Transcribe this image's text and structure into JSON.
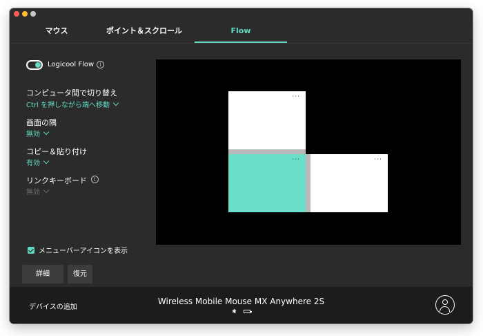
{
  "tabs": [
    {
      "label": "マウス"
    },
    {
      "label": "ポイント＆スクロール"
    },
    {
      "label": "Flow"
    }
  ],
  "flow": {
    "toggle_label": "Logicool Flow",
    "toggle_on": true
  },
  "settings": [
    {
      "title": "コンピュータ間で切り替え",
      "value": "Ctrl を押しながら端へ移動"
    },
    {
      "title": "画面の隅",
      "value": "無効"
    },
    {
      "title": "コピー＆貼り付け",
      "value": "有効"
    },
    {
      "title": "リンクキーボード",
      "value": "無効"
    }
  ],
  "menubar_checkbox_label": "メニューバーアイコンを表示",
  "buttons": {
    "detail": "詳細",
    "restore": "復元"
  },
  "screens": {
    "menu_dots": "···"
  },
  "footer": {
    "add_device": "デバイスの追加",
    "device_name": "Wireless Mobile Mouse MX Anywhere 2S",
    "bluetooth_glyph": "✱"
  },
  "colors": {
    "accent": "#62d9c2",
    "active_screen": "#6ae0cb",
    "window_bg": "#2b2b2b",
    "footer_bg": "#1c1c1c"
  },
  "icons": [
    "info-icon",
    "chevron-down-icon",
    "bluetooth-icon",
    "battery-icon",
    "account-icon"
  ]
}
